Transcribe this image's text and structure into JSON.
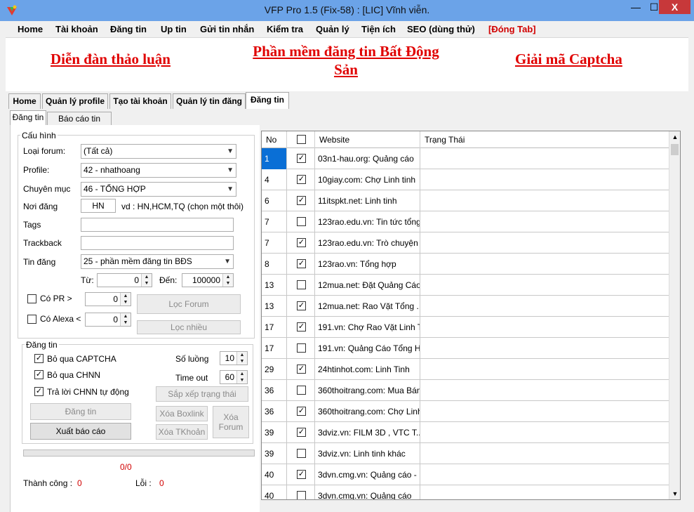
{
  "window": {
    "title": "VFP Pro 1.5 (Fix-58) : [LIC] Vĩnh viễn.",
    "min_glyph": "—",
    "max_glyph": "☐",
    "close_glyph": "X"
  },
  "menu": [
    {
      "label": "Home"
    },
    {
      "label": "Tài khoản"
    },
    {
      "label": "Đăng tin"
    },
    {
      "label": "Up tin"
    },
    {
      "label": "Gửi tin nhắn"
    },
    {
      "label": "Kiểm tra"
    },
    {
      "label": "Quản lý"
    },
    {
      "label": "Tiện ích"
    },
    {
      "label": "SEO (dùng thử)"
    },
    {
      "label": "[Đóng Tab]"
    }
  ],
  "banner": {
    "forum": "Diễn đàn thảo luận",
    "software_line1": "Phần mềm đăng tin Bất Động",
    "software_line2": "Sản",
    "captcha": "Giải mã Captcha"
  },
  "tabs": [
    {
      "label": "Home"
    },
    {
      "label": "Quản lý profile"
    },
    {
      "label": "Tạo tài khoản"
    },
    {
      "label": "Quản lý tin đăng"
    },
    {
      "label": "Đăng tin"
    }
  ],
  "subtabs": [
    {
      "label": "Đăng tin"
    },
    {
      "label": "Báo cáo tin đăng"
    }
  ],
  "config": {
    "legend": "Cấu hình",
    "forum_type_label": "Loại forum:",
    "forum_type_value": "(Tất cả)",
    "profile_label": "Profile:",
    "profile_value": "42 - nhathoang",
    "category_label": "Chuyên mục",
    "category_value": "46 - TỔNG HỢP",
    "location_label": "Nơi đăng",
    "location_value": "HN",
    "location_hint": "vd : HN,HCM,TQ (chọn một thôi)",
    "tags_label": "Tags",
    "tags_value": "",
    "trackback_label": "Trackback",
    "trackback_value": "",
    "post_label": "Tin đăng",
    "post_value": "25 - phần mềm đăng tin BĐS",
    "from_label": "Từ:",
    "from_value": "0",
    "to_label": "Đến:",
    "to_value": "100000",
    "pr_label": "Có PR >",
    "pr_value": "0",
    "alexa_label": "Có Alexa <",
    "alexa_value": "0",
    "filter_forum": "Lọc Forum",
    "filter_many": "Lọc nhiều"
  },
  "posting": {
    "legend": "Đăng tin",
    "skip_captcha": "Bỏ qua CAPTCHA",
    "skip_chnn": "Bỏ qua CHNN",
    "auto_answer": "Trả lời CHNN tự động",
    "threads_label": "Số luồng",
    "threads_value": "10",
    "timeout_label": "Time out",
    "timeout_value": "60",
    "sort_status": "Sắp xếp trạng thái",
    "post_button": "Đăng tin",
    "delete_boxlink": "Xóa Boxlink",
    "delete_forum_line1": "Xóa",
    "delete_forum_line2": "Forum",
    "export_report": "Xuất báo cáo",
    "delete_account": "Xóa TKhoản"
  },
  "status": {
    "progress_text": "0/0",
    "progress_fraction": 0,
    "success_label": "Thành công :",
    "success_value": "0",
    "error_label": "Lỗi :",
    "error_value": "0"
  },
  "grid": {
    "columns": {
      "no": "No",
      "website": "Website",
      "status": "Trạng Thái"
    },
    "rows": [
      {
        "no": "1",
        "checked": true,
        "website": "03n1-hau.org: Quảng cáo",
        "status": ""
      },
      {
        "no": "4",
        "checked": true,
        "website": "10giay.com: Chợ Linh tinh",
        "status": ""
      },
      {
        "no": "6",
        "checked": true,
        "website": "11itspkt.net: Linh tinh",
        "status": ""
      },
      {
        "no": "7",
        "checked": false,
        "website": "123rao.edu.vn: Tin tức tổng...",
        "status": ""
      },
      {
        "no": "7",
        "checked": true,
        "website": "123rao.edu.vn: Trò chuyện ...",
        "status": ""
      },
      {
        "no": "8",
        "checked": true,
        "website": "123rao.vn: Tổng hợp",
        "status": ""
      },
      {
        "no": "13",
        "checked": false,
        "website": "12mua.net: Đặt Quảng Cáo ...",
        "status": ""
      },
      {
        "no": "13",
        "checked": true,
        "website": "12mua.net: Rao Vặt Tổng ...",
        "status": ""
      },
      {
        "no": "17",
        "checked": true,
        "website": "191.vn: Chợ Rao Vặt Linh T...",
        "status": ""
      },
      {
        "no": "17",
        "checked": false,
        "website": "191.vn: Quảng Cáo Tổng H...",
        "status": ""
      },
      {
        "no": "29",
        "checked": true,
        "website": "24htinhot.com: Linh Tinh",
        "status": ""
      },
      {
        "no": "36",
        "checked": false,
        "website": "360thoitrang.com: Mua Bán...",
        "status": ""
      },
      {
        "no": "36",
        "checked": true,
        "website": "360thoitrang.com: Chợ Linh ...",
        "status": ""
      },
      {
        "no": "39",
        "checked": true,
        "website": "3dviz.vn: FILM 3D , VTC T...",
        "status": ""
      },
      {
        "no": "39",
        "checked": false,
        "website": "3dviz.vn: Linh tinh khác",
        "status": ""
      },
      {
        "no": "40",
        "checked": true,
        "website": "3dvn.cmg.vn: Quảng cáo - ...",
        "status": ""
      },
      {
        "no": "40",
        "checked": false,
        "website": "3dvn.cmg.vn: Quảng cáo",
        "status": ""
      }
    ]
  },
  "colors": {
    "titlebar": "#6ba3e8",
    "close": "#c7383a",
    "link_red": "#e00000",
    "selected": "#0a6fd6"
  }
}
